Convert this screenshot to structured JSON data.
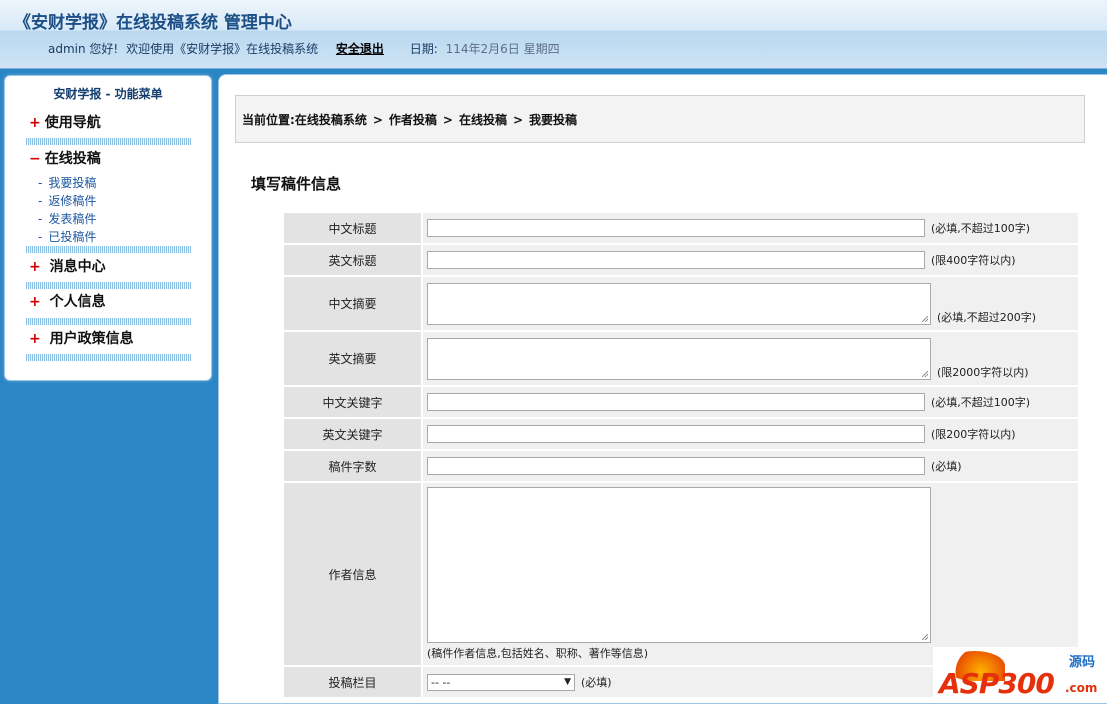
{
  "header": {
    "title": "《安财学报》在线投稿系统 管理中心",
    "user": "admin 您好!",
    "welcome": "欢迎使用《安财学报》在线投稿系统",
    "logout": "安全退出",
    "date_label": "日期:",
    "date_value": "114年2月6日 星期四"
  },
  "sidebar": {
    "title": "安财学报 - 功能菜单",
    "groups": [
      {
        "sign": "+",
        "label": "使用导航"
      },
      {
        "sign": "−",
        "label": "在线投稿",
        "items": [
          "我要投稿",
          "返修稿件",
          "发表稿件",
          "已投稿件"
        ]
      },
      {
        "sign": "+",
        "label": "消息中心"
      },
      {
        "sign": "+",
        "label": "个人信息"
      },
      {
        "sign": "+",
        "label": "用户政策信息"
      }
    ],
    "sub_dash": "-"
  },
  "breadcrumb": {
    "prefix": "当前位置:",
    "items": [
      "在线投稿系统",
      "作者投稿",
      "在线投稿",
      "我要投稿"
    ],
    "separator": ">"
  },
  "form": {
    "title": "填写稿件信息",
    "rows": [
      {
        "label": "中文标题",
        "hint": "(必填,不超过100字)"
      },
      {
        "label": "英文标题",
        "hint": "(限400字符以内)"
      },
      {
        "label": "中文摘要",
        "hint": "(必填,不超过200字)"
      },
      {
        "label": "英文摘要",
        "hint": "(限2000字符以内)"
      },
      {
        "label": "中文关键字",
        "hint": "(必填,不超过100字)"
      },
      {
        "label": "英文关键字",
        "hint": "(限200字符以内)"
      },
      {
        "label": "稿件字数",
        "hint": "(必填)"
      },
      {
        "label": "作者信息",
        "hint": "(稿件作者信息,包括姓名、职称、著作等信息)"
      },
      {
        "label": "投稿栏目",
        "hint": "(必填)",
        "select_value": "-- --"
      }
    ]
  },
  "watermark": {
    "brand": "ASP300",
    "code": "源码",
    "domain": ".com"
  },
  "colors": {
    "background": "#2a86c4",
    "header_text": "#1c4f86",
    "accent_red": "#d30000"
  }
}
